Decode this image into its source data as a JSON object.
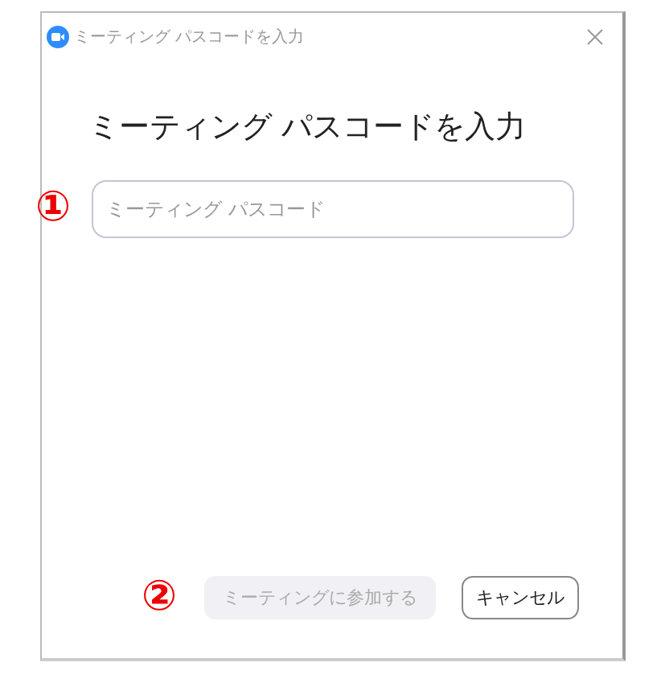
{
  "window": {
    "title": "ミーティング パスコードを入力"
  },
  "heading": "ミーティング パスコードを入力",
  "password_field": {
    "placeholder": "ミーティング パスコード",
    "marker": "①"
  },
  "buttons": [
    {
      "label": "ミーティングに参加する",
      "kind": "primary",
      "disabled": true
    },
    {
      "label": "キャンセル",
      "kind": "secondary",
      "disabled": false
    }
  ],
  "buttons_marker": "②"
}
